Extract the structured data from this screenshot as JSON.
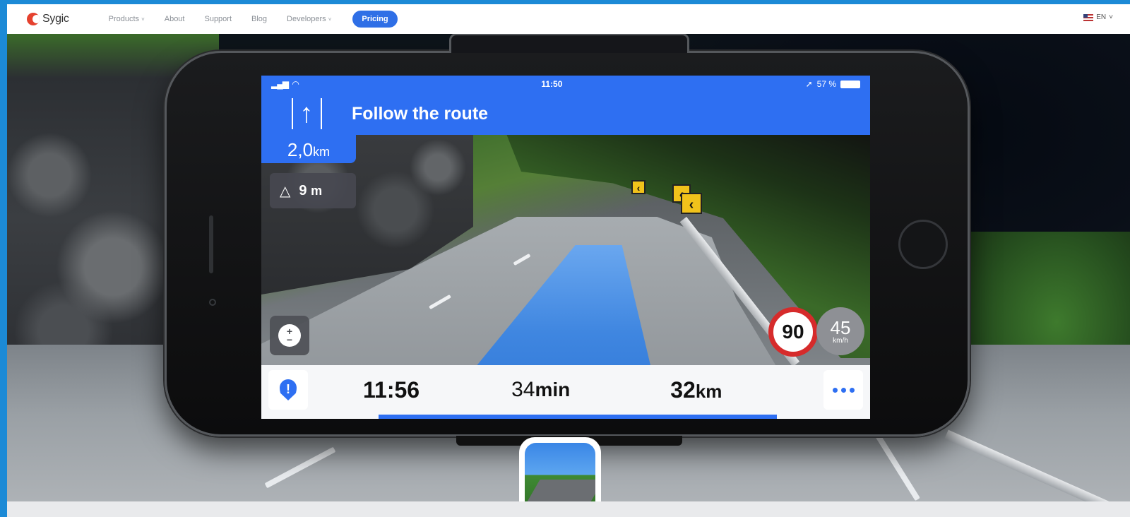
{
  "nav": {
    "logo_text": "Sygic",
    "items": [
      {
        "label": "Products",
        "caret": "˅"
      },
      {
        "label": "About"
      },
      {
        "label": "Support"
      },
      {
        "label": "Blog"
      },
      {
        "label": "Developers",
        "caret": "˅"
      }
    ],
    "pricing_label": "Pricing",
    "language": "EN",
    "language_caret": "˅"
  },
  "phone": {
    "status": {
      "time": "11:50",
      "battery": "57 %"
    },
    "instruction": "Follow the route",
    "distance": {
      "value": "2,0",
      "unit": "km"
    },
    "hazard": {
      "value": "9",
      "unit": "m"
    },
    "speed_limit": "90",
    "current_speed": {
      "value": "45",
      "unit": "km/h"
    },
    "info": {
      "eta": "11:56",
      "duration": {
        "value": "34",
        "unit": "min"
      },
      "remaining": {
        "value": "32",
        "unit": "km"
      }
    },
    "route_progress": 0.81
  },
  "colors": {
    "brand_blue": "#2e6ff2",
    "logo_red": "#e5412e",
    "speed_red": "#d62b2b",
    "frame_blue": "#1c8ad6"
  }
}
